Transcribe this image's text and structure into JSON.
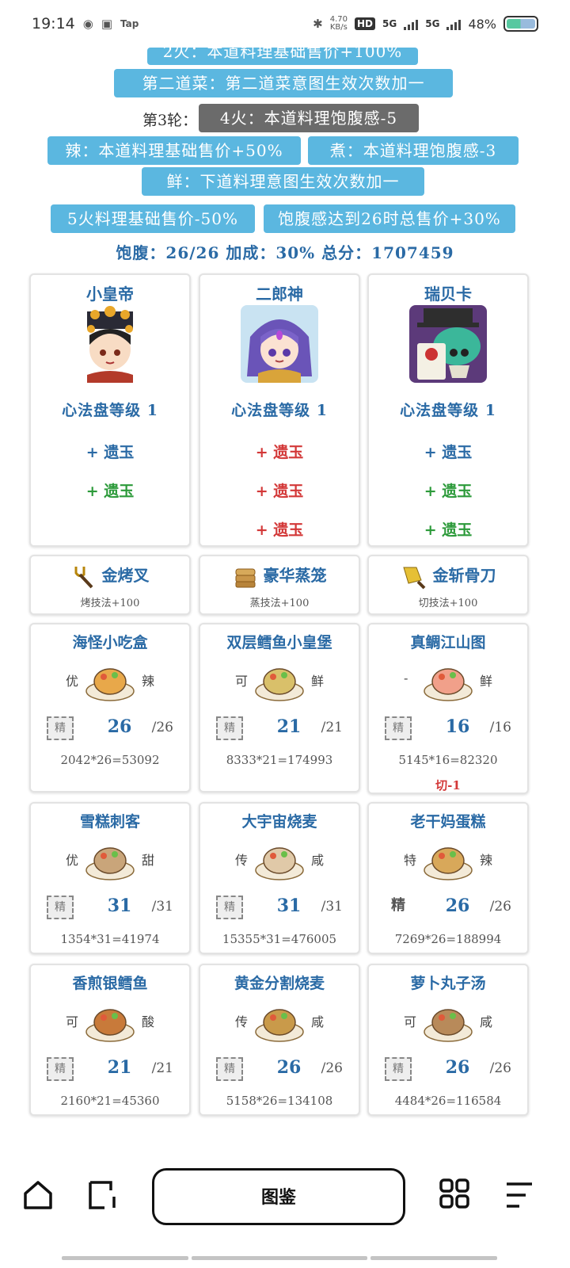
{
  "status": {
    "time": "19:14",
    "tap": "Tap",
    "speed_value": "4.70",
    "speed_unit": "KB/s",
    "hd": "HD",
    "net1": "5G",
    "net2": "5G",
    "battery": "48%"
  },
  "buffs": {
    "top_cut": "2火：本道料理基础售价+100%",
    "second_dish": "第二道菜：第二道菜意图生效次数加一",
    "round_label": "第3轮：",
    "round_effect": "4火：本道料理饱腹感-5",
    "spicy": "辣：本道料理基础售价+50%",
    "boil": "煮：本道料理饱腹感-3",
    "fresh": "鲜：下道料理意图生效次数加一",
    "fire5": "5火料理基础售价-50%",
    "satiety": "饱腹感达到26时总售价+30%"
  },
  "summary": "饱腹：26/26 加成：30% 总分：1707459",
  "chefs": [
    {
      "name": "小皇帝",
      "level": "心法盘等级 1",
      "jades": [
        {
          "text": "+ 遗玉"
        },
        {
          "text": "+ 遗玉"
        }
      ]
    },
    {
      "name": "二郎神",
      "level": "心法盘等级 1",
      "jades": [
        {
          "text": "+ 遗玉"
        },
        {
          "text": "+ 遗玉"
        },
        {
          "text": "+ 遗玉"
        }
      ]
    },
    {
      "name": "瑞贝卡",
      "level": "心法盘等级 1",
      "jades": [
        {
          "text": "+ 遗玉"
        },
        {
          "text": "+ 遗玉"
        },
        {
          "text": "+ 遗玉"
        }
      ]
    }
  ],
  "tools": [
    {
      "name": "金烤叉",
      "desc": "烤技法+100"
    },
    {
      "name": "豪华蒸笼",
      "desc": "蒸技法+100"
    },
    {
      "name": "金斩骨刀",
      "desc": "切技法+100"
    }
  ],
  "dishes": [
    {
      "name": "海怪小吃盒",
      "left": "优",
      "right": "辣",
      "mark": "精",
      "count": "26",
      "total": "/26",
      "formula": "2042*26=53092",
      "extra": ""
    },
    {
      "name": "双层鳕鱼小皇堡",
      "left": "可",
      "right": "鲜",
      "mark": "精",
      "count": "21",
      "total": "/21",
      "formula": "8333*21=174993",
      "extra": ""
    },
    {
      "name": "真鲷江山图",
      "left": "-",
      "right": "鲜",
      "mark": "精",
      "count": "16",
      "total": "/16",
      "formula": "5145*16=82320",
      "extra": "切-1"
    },
    {
      "name": "雪糕刺客",
      "left": "优",
      "right": "甜",
      "mark": "精",
      "count": "31",
      "total": "/31",
      "formula": "1354*31=41974",
      "extra": ""
    },
    {
      "name": "大宇宙烧麦",
      "left": "传",
      "right": "咸",
      "mark": "精",
      "count": "31",
      "total": "/31",
      "formula": "15355*31=476005",
      "extra": ""
    },
    {
      "name": "老干妈蛋糕",
      "left": "特",
      "right": "辣",
      "mark": "精",
      "count": "26",
      "total": "/26",
      "formula": "7269*26=188994",
      "extra": ""
    },
    {
      "name": "香煎银鳕鱼",
      "left": "可",
      "right": "酸",
      "mark": "精",
      "count": "21",
      "total": "/21",
      "formula": "2160*21=45360",
      "extra": ""
    },
    {
      "name": "黄金分割烧麦",
      "left": "传",
      "right": "咸",
      "mark": "精",
      "count": "26",
      "total": "/26",
      "formula": "5158*26=134108",
      "extra": ""
    },
    {
      "name": "萝卜丸子汤",
      "left": "可",
      "right": "咸",
      "mark": "精",
      "count": "26",
      "total": "/26",
      "formula": "4484*26=116584",
      "extra": ""
    }
  ],
  "nav": {
    "center_label": "图鉴"
  }
}
